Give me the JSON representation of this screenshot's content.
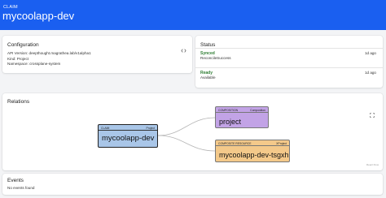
{
  "header": {
    "kind": "CLAIM",
    "title": "mycoolapp-dev"
  },
  "configuration": {
    "title": "Configuration",
    "api_version": "API Version: deepthought.magrathea.lab/v1alpha1",
    "kind": "Kind: Project",
    "namespace": "Namespace: crossplane-system",
    "action_icon": "code-icon"
  },
  "status": {
    "title": "Status",
    "conditions": [
      {
        "name": "Synced",
        "reason": "ReconcileSuccess",
        "age": "1d ago"
      },
      {
        "name": "Ready",
        "reason": "Available",
        "age": "1d ago"
      }
    ]
  },
  "relations": {
    "title": "Relations",
    "expand_icon": "expand-icon",
    "watermark": "React Flow",
    "nodes": {
      "claim": {
        "type": "CLAIM",
        "kind": "Project",
        "name": "mycoolapp-dev",
        "color": "#a9c6e8"
      },
      "composition": {
        "type": "COMPOSITION",
        "kind": "Composition",
        "name": "project",
        "color": "#c2a3e6"
      },
      "composite": {
        "type": "COMPOSITE RESOURCE",
        "kind": "XProject",
        "name": "mycoolapp-dev-tsgxh",
        "color": "#f4c98a"
      }
    }
  },
  "events": {
    "title": "Events",
    "empty_text": "No events found"
  },
  "colors": {
    "header": "#1a5ff0",
    "condition_ok": "#2e7d32",
    "background": "#f3f4f6"
  }
}
